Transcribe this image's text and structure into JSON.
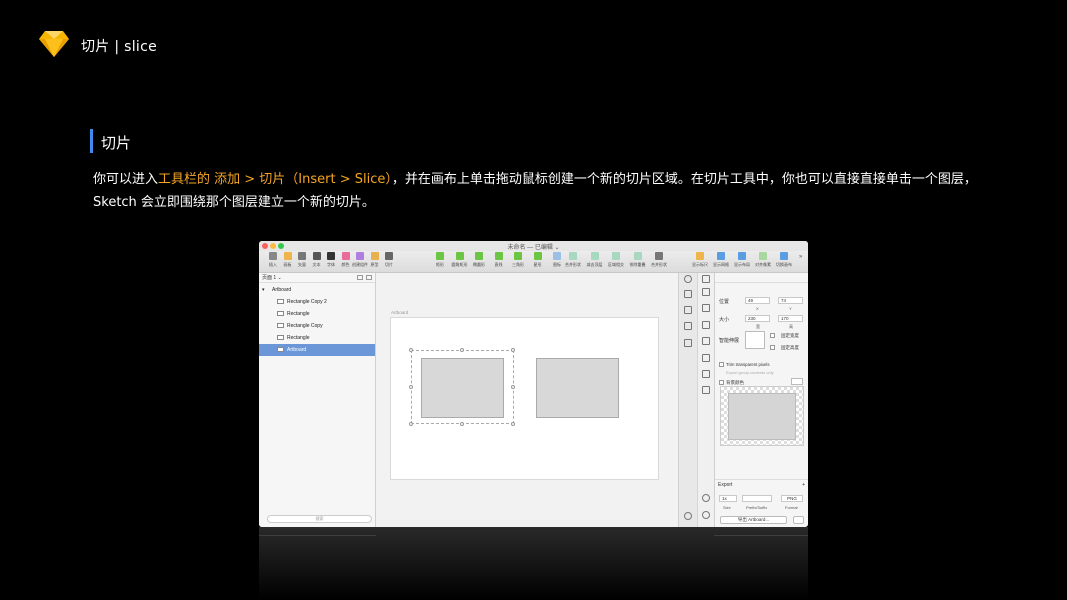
{
  "header": {
    "title": "切片 | slice"
  },
  "section": {
    "title": "切片"
  },
  "description": {
    "part1": "你可以进入",
    "highlight": "工具栏的 添加 > 切片（Insert > Slice）",
    "part2": "，并在画布上单击拖动鼠标创建一个新的切片区域。在切片工具中，你也可以直接直接单击一个图层，Sketch 会立即围绕那个图层建立一个新的切片。"
  },
  "window": {
    "title": "未命名 — 已编辑 ⌄"
  },
  "toolbar": {
    "left": [
      {
        "label": "插入",
        "icon": "plus-icon",
        "color": "#888888"
      },
      {
        "label": "画板",
        "icon": "artboard-icon",
        "color": "#f0b54a"
      },
      {
        "label": "矢量",
        "icon": "vector-icon",
        "color": "#777777"
      },
      {
        "label": "文本",
        "icon": "text-icon",
        "color": "#555555"
      },
      {
        "label": "字体",
        "icon": "font-icon",
        "color": "#333333"
      },
      {
        "label": "颜色",
        "icon": "color-icon",
        "color": "#e86b9c"
      },
      {
        "label": "创建组件",
        "icon": "component-icon",
        "color": "#b07de0"
      },
      {
        "label": "原型",
        "icon": "prototype-icon",
        "color": "#e8b04f"
      },
      {
        "label": "切片",
        "icon": "slice-icon",
        "color": "#666666"
      }
    ],
    "shapes": [
      {
        "label": "矩形",
        "icon": "rectangle-icon",
        "color": "#6cc644"
      },
      {
        "label": "圆角矩形",
        "icon": "rounded-rectangle-icon",
        "color": "#6cc644"
      },
      {
        "label": "椭圆形",
        "icon": "oval-icon",
        "color": "#6cc644"
      },
      {
        "label": "直线",
        "icon": "line-icon",
        "color": "#6cc644"
      },
      {
        "label": "三角形",
        "icon": "triangle-icon",
        "color": "#6cc644"
      },
      {
        "label": "星形",
        "icon": "star-icon",
        "color": "#6cc644"
      },
      {
        "label": "图标",
        "icon": "icon-shape-icon",
        "color": "#9cc0e4"
      }
    ],
    "ops": [
      {
        "label": "合并形状",
        "icon": "union-icon",
        "color": "#a8d8c0"
      },
      {
        "label": "减去顶层",
        "icon": "subtract-icon",
        "color": "#a8d8c0"
      },
      {
        "label": "区域相交",
        "icon": "intersect-icon",
        "color": "#a8d8c0"
      },
      {
        "label": "排除重叠",
        "icon": "difference-icon",
        "color": "#a8d8c0"
      },
      {
        "label": "合并形状",
        "icon": "combine-icon",
        "color": "#777777"
      }
    ],
    "right": [
      {
        "label": "显示标尺",
        "icon": "ruler-icon",
        "color": "#f0b54a"
      },
      {
        "label": "显示网格",
        "icon": "grid-icon",
        "color": "#5a9de0"
      },
      {
        "label": "显示布局",
        "icon": "layout-icon",
        "color": "#5a9de0"
      },
      {
        "label": "对齐像素",
        "icon": "pixel-icon",
        "color": "#a8d8a0"
      },
      {
        "label": "切换画布",
        "icon": "canvas-icon",
        "color": "#5a9de0"
      }
    ]
  },
  "layers": {
    "pages_label": "页面 1 ⌄",
    "items": [
      {
        "name": "Artboard",
        "kind": "group"
      },
      {
        "name": "Rectangle Copy 2",
        "kind": "slice"
      },
      {
        "name": "Rectangle",
        "kind": "slice"
      },
      {
        "name": "Rectangle Copy",
        "kind": "shape"
      },
      {
        "name": "Rectangle",
        "kind": "shape"
      },
      {
        "name": "Artboard",
        "kind": "slice"
      }
    ],
    "search_placeholder": "搜索"
  },
  "canvas": {
    "artboard_label": "Artboard"
  },
  "inspector": {
    "position_label": "位置",
    "x": "49",
    "y": "74",
    "x_label": "X",
    "y_label": "Y",
    "size_label": "大小",
    "width": "230",
    "height": "170",
    "w_label": "宽",
    "h_label": "高",
    "smart_label": "智能伸展",
    "fix_width": "固定宽度",
    "fix_height": "固定高度",
    "trim": "Trim transparent pixels",
    "export_group": "Export group contents only",
    "bg_color": "背景颜色",
    "export_title": "Export",
    "export_size": "1x",
    "export_format": "PNG",
    "size_sub": "Size",
    "prefix_sub": "Prefix/Suffix",
    "format_sub": "Format",
    "export_button": "导出 Artboard..."
  }
}
